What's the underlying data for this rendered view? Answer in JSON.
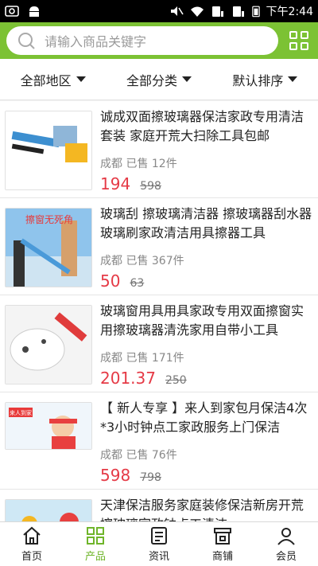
{
  "status_bar": {
    "time": "下午2:44",
    "battery": "?"
  },
  "search": {
    "placeholder": "请输入商品关键字"
  },
  "filters": [
    {
      "label": "全部地区"
    },
    {
      "label": "全部分类"
    },
    {
      "label": "默认排序"
    }
  ],
  "products": [
    {
      "title": "诚成双面擦玻璃器保洁家政专用清洁套装 家庭开荒大扫除工具包邮",
      "meta": "成都 已售 12件",
      "price": "194",
      "orig": "598",
      "thumb_text": ""
    },
    {
      "title": "玻璃刮 擦玻璃清洁器 擦玻璃器刮水器玻璃刷家政清洁用具擦器工具",
      "meta": "成都 已售 367件",
      "price": "50",
      "orig": "63",
      "thumb_text": "擦窗无死角"
    },
    {
      "title": "玻璃窗用具用具家政专用双面擦窗实用擦玻璃器清洗家用自带小工具",
      "meta": "成都 已售 171件",
      "price": "201.37",
      "orig": "250",
      "thumb_text": ""
    },
    {
      "title": "【 新人专享 】来人到家包月保洁4次*3小时钟点工家政服务上门保洁",
      "meta": "成都 已售 76件",
      "price": "598",
      "orig": "798",
      "thumb_text": "来人到家"
    },
    {
      "title": "天津保洁服务家庭装修保洁新房开荒擦玻璃家政钟点工清洁",
      "meta": "",
      "price": "",
      "orig": "",
      "thumb_text": ""
    }
  ],
  "tabs": [
    {
      "label": "首页",
      "icon": "home-icon"
    },
    {
      "label": "产品",
      "icon": "products-grid-icon"
    },
    {
      "label": "资讯",
      "icon": "news-icon"
    },
    {
      "label": "商铺",
      "icon": "store-icon"
    },
    {
      "label": "会员",
      "icon": "user-icon"
    }
  ],
  "colors": {
    "header": "#7cc234",
    "price": "#e53a46",
    "active_tab": "#6fb52a"
  }
}
